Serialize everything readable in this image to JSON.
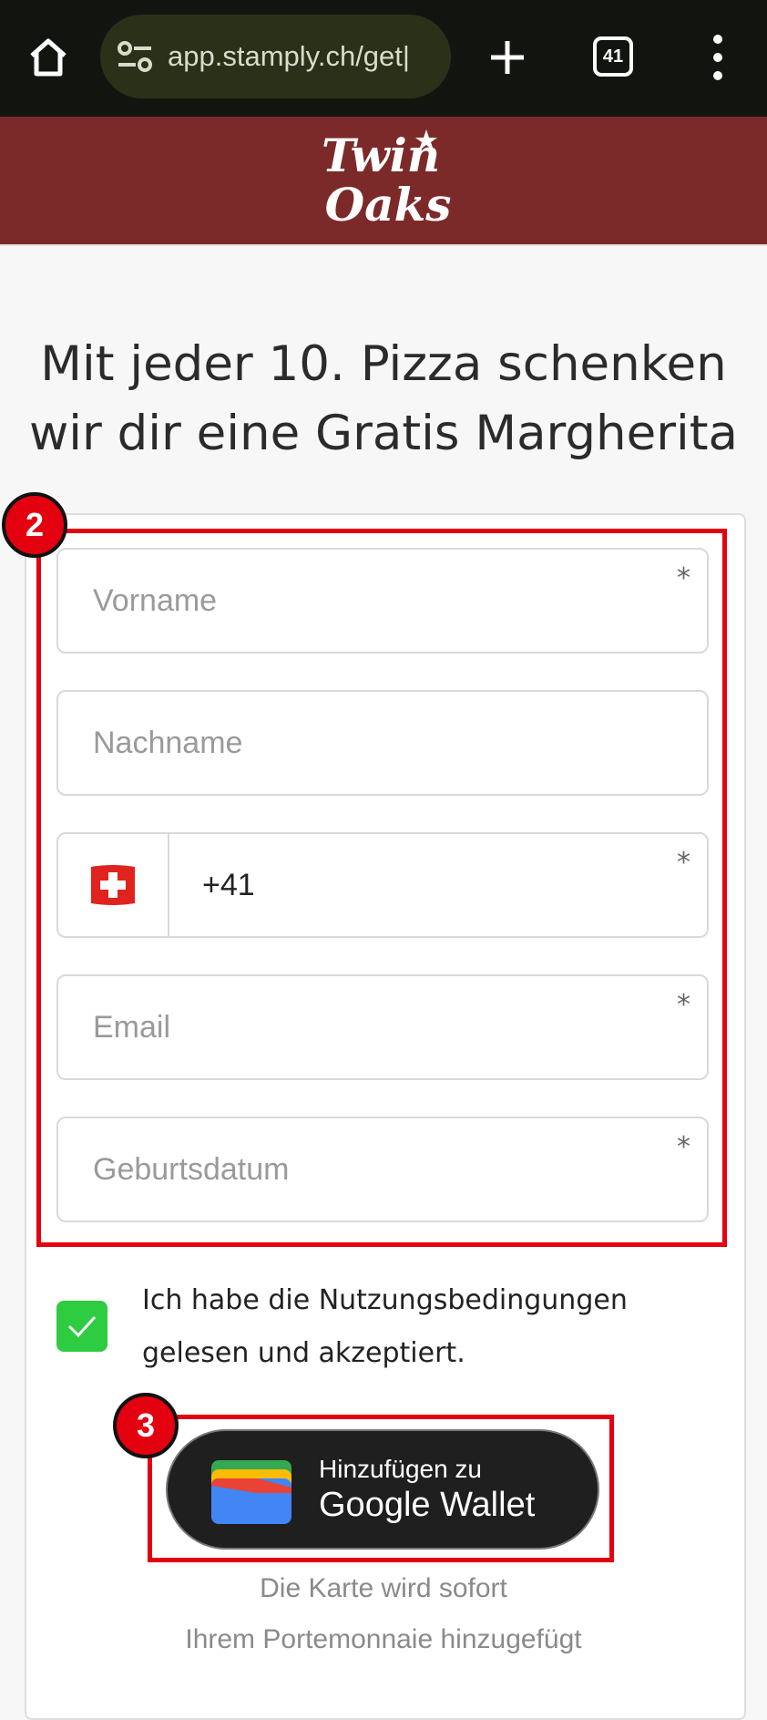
{
  "browser": {
    "url": "app.stamply.ch/get|",
    "tab_count": "41",
    "icons": [
      "home-icon",
      "site-settings-icon",
      "plus-icon",
      "tab-switcher-icon",
      "more-vert-icon"
    ]
  },
  "brand": {
    "logo_text": "Twin Oaks",
    "bar_color": "#7c2a29"
  },
  "headline": {
    "line1": "Mit jeder 10. Pizza schenken",
    "line2": "wir dir eine Gratis Margherita"
  },
  "form": {
    "firstname_placeholder": "Vorname",
    "lastname_placeholder": "Nachname",
    "phone_value": "+41",
    "phone_country": "CH",
    "email_placeholder": "Email",
    "birthday_placeholder": "Geburtsdatum",
    "required_marker": "*"
  },
  "annotations": {
    "form_number": "2",
    "wallet_number": "3",
    "color": "#e3000f"
  },
  "terms": {
    "checked": true,
    "line1": "Ich habe die Nutzungsbedingungen",
    "line2": "gelesen und akzeptiert."
  },
  "wallet_button": {
    "line1": "Hinzufügen zu",
    "line2": "Google Wallet"
  },
  "footer_note": {
    "line1": "Die Karte wird sofort",
    "line2": "Ihrem Portemonnaie hinzugefügt"
  }
}
